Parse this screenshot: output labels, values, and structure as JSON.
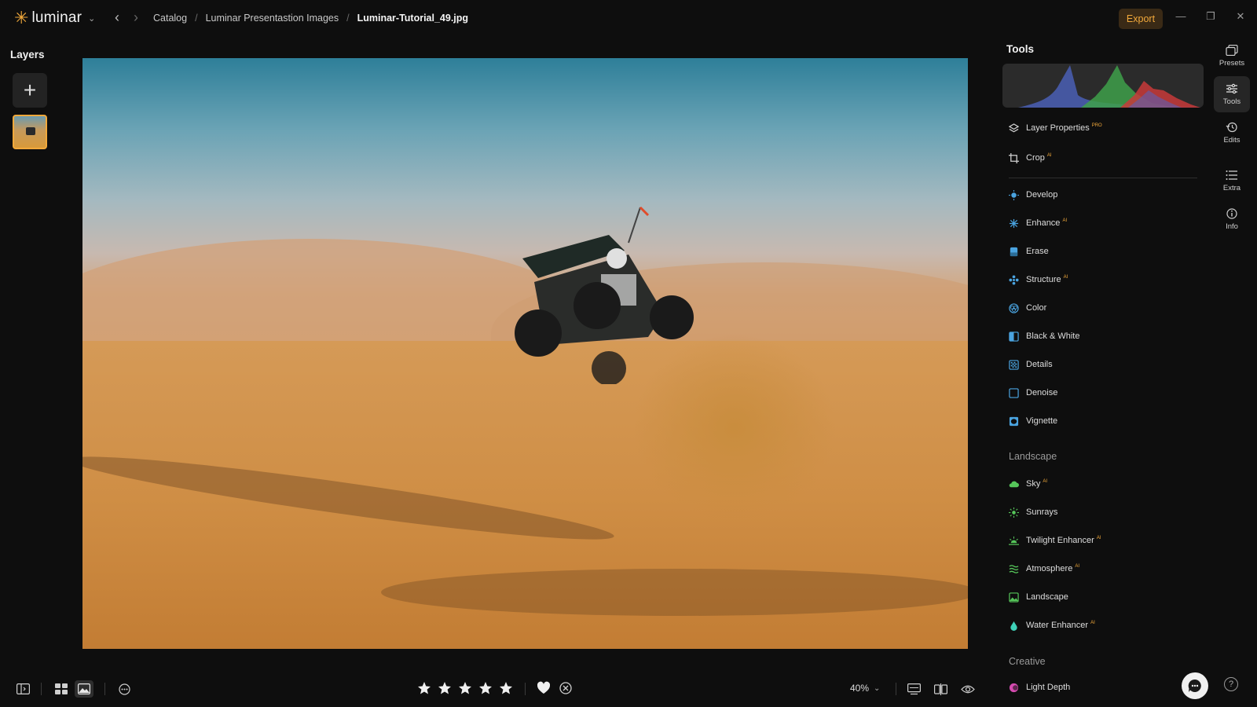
{
  "app": {
    "name": "luminar"
  },
  "breadcrumb": {
    "items": [
      "Catalog",
      "Luminar Presentastion Images"
    ],
    "current": "Luminar-Tutorial_49.jpg",
    "separator": "/"
  },
  "header": {
    "export_label": "Export"
  },
  "layers": {
    "title": "Layers",
    "add_label": "+"
  },
  "tools": {
    "title": "Tools",
    "top_items": [
      {
        "label": "Layer Properties",
        "badge": "PRO"
      },
      {
        "label": "Crop",
        "badge": "AI"
      }
    ],
    "essentials": [
      {
        "label": "Develop",
        "badge": ""
      },
      {
        "label": "Enhance",
        "badge": "AI"
      },
      {
        "label": "Erase",
        "badge": ""
      },
      {
        "label": "Structure",
        "badge": "AI"
      },
      {
        "label": "Color",
        "badge": ""
      },
      {
        "label": "Black & White",
        "badge": ""
      },
      {
        "label": "Details",
        "badge": ""
      },
      {
        "label": "Denoise",
        "badge": ""
      },
      {
        "label": "Vignette",
        "badge": ""
      }
    ],
    "landscape_title": "Landscape",
    "landscape": [
      {
        "label": "Sky",
        "badge": "AI"
      },
      {
        "label": "Sunrays",
        "badge": ""
      },
      {
        "label": "Twilight Enhancer",
        "badge": "AI"
      },
      {
        "label": "Atmosphere",
        "badge": "AI"
      },
      {
        "label": "Landscape",
        "badge": ""
      },
      {
        "label": "Water Enhancer",
        "badge": "AI"
      }
    ],
    "creative_title": "Creative",
    "creative": [
      {
        "label": "Light Depth",
        "badge": ""
      }
    ]
  },
  "rail": [
    {
      "label": "Presets",
      "icon": "presets-icon"
    },
    {
      "label": "Tools",
      "icon": "tools-icon"
    },
    {
      "label": "Edits",
      "icon": "history-icon"
    },
    {
      "label": "Extra",
      "icon": "list-icon"
    },
    {
      "label": "Info",
      "icon": "info-icon"
    }
  ],
  "bottom": {
    "zoom": "40%",
    "rating": 5
  },
  "colors": {
    "accent": "#f2a93b",
    "background": "#0e0e0e",
    "panel": "#232323",
    "tool_icon": "#4aa3df"
  }
}
